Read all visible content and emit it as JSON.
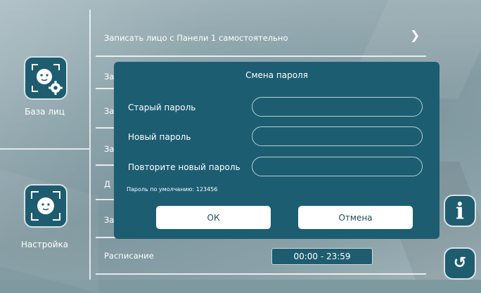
{
  "sidebar": {
    "items": [
      {
        "label": "База лиц",
        "icon": "face-settings-icon"
      },
      {
        "label": "Настройка",
        "icon": "face-scan-icon"
      }
    ]
  },
  "list": {
    "rows": [
      {
        "label": "Записать лицо с Панели 1 самостоятельно"
      },
      {
        "label": "За"
      },
      {
        "label": "За"
      },
      {
        "label": "За"
      },
      {
        "label": "Д"
      },
      {
        "label": "За"
      },
      {
        "label": "Расписание",
        "value": "00:00 - 23:59"
      }
    ]
  },
  "dialog": {
    "title": "Смена пароля",
    "fields": [
      {
        "label": "Старый пароль",
        "value": "",
        "placeholder": ""
      },
      {
        "label": "Новый пароль",
        "value": "",
        "placeholder": ""
      },
      {
        "label": "Повторите новый пароль",
        "value": "",
        "placeholder": ""
      }
    ],
    "hint": "Пароль по умолчанию: 123456",
    "ok_label": "ОК",
    "cancel_label": "Отмена"
  },
  "buttons": {
    "info_icon": "info-icon",
    "back_icon": "back-icon"
  },
  "colors": {
    "panel": "#1c5d72",
    "icon_bg": "#1e5c70",
    "button_bg": "#ffffff",
    "button_text": "#1b4c5c"
  }
}
